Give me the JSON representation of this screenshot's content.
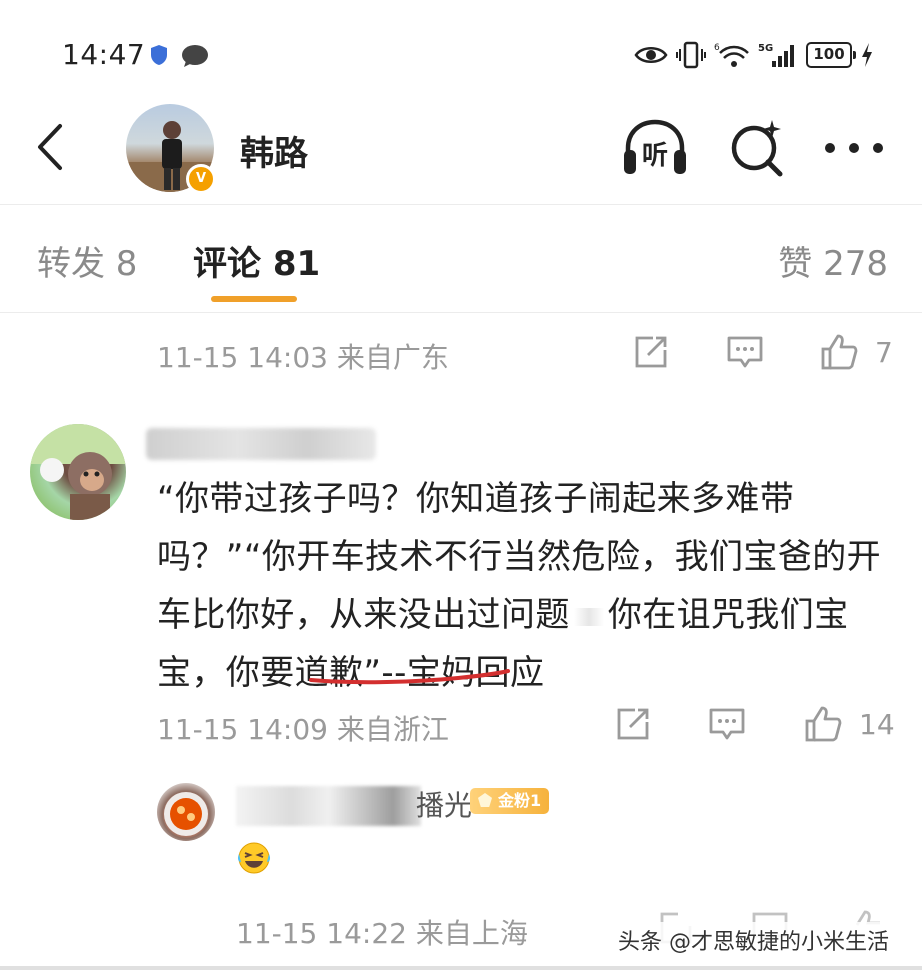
{
  "status_bar": {
    "time": "14:47",
    "battery": "100"
  },
  "header": {
    "username": "韩路",
    "listen_label": "听",
    "verified_mark": "V"
  },
  "tabs": {
    "repost": "转发 8",
    "comments": "评论 81",
    "likes": "赞 278",
    "active_color": "#f0a02a"
  },
  "prev_comment": {
    "meta": "11-15 14:03 来自广东",
    "likes": "7"
  },
  "comment": {
    "text_before": "“你带过孩子吗？你知道孩子闹起来多难带吗？”“你开车技术不行当然危险，我们宝爸的开车比你好，从来没出过问题",
    "text_after": "你在诅咒我们宝宝，你要道歉”--宝妈回应",
    "meta": "11-15 14:09 来自浙江",
    "likes": "14",
    "underline_color": "#d32f2f"
  },
  "reply": {
    "name_suffix": "播光",
    "fan_badge": "金粉1",
    "meta": "11-15 14:22 来自上海"
  },
  "watermark": "头条 @才思敏捷的小米生活",
  "icons": [
    "shield-icon",
    "chat-bubble-icon",
    "eye-icon",
    "vibrate-icon",
    "wifi-icon",
    "signal-icon",
    "battery-icon",
    "charging-icon",
    "back-icon",
    "headphones-icon",
    "search-sparkle-icon",
    "more-icon",
    "share-icon",
    "comment-icon",
    "thumbs-up-icon",
    "laughing-emoji-icon"
  ]
}
